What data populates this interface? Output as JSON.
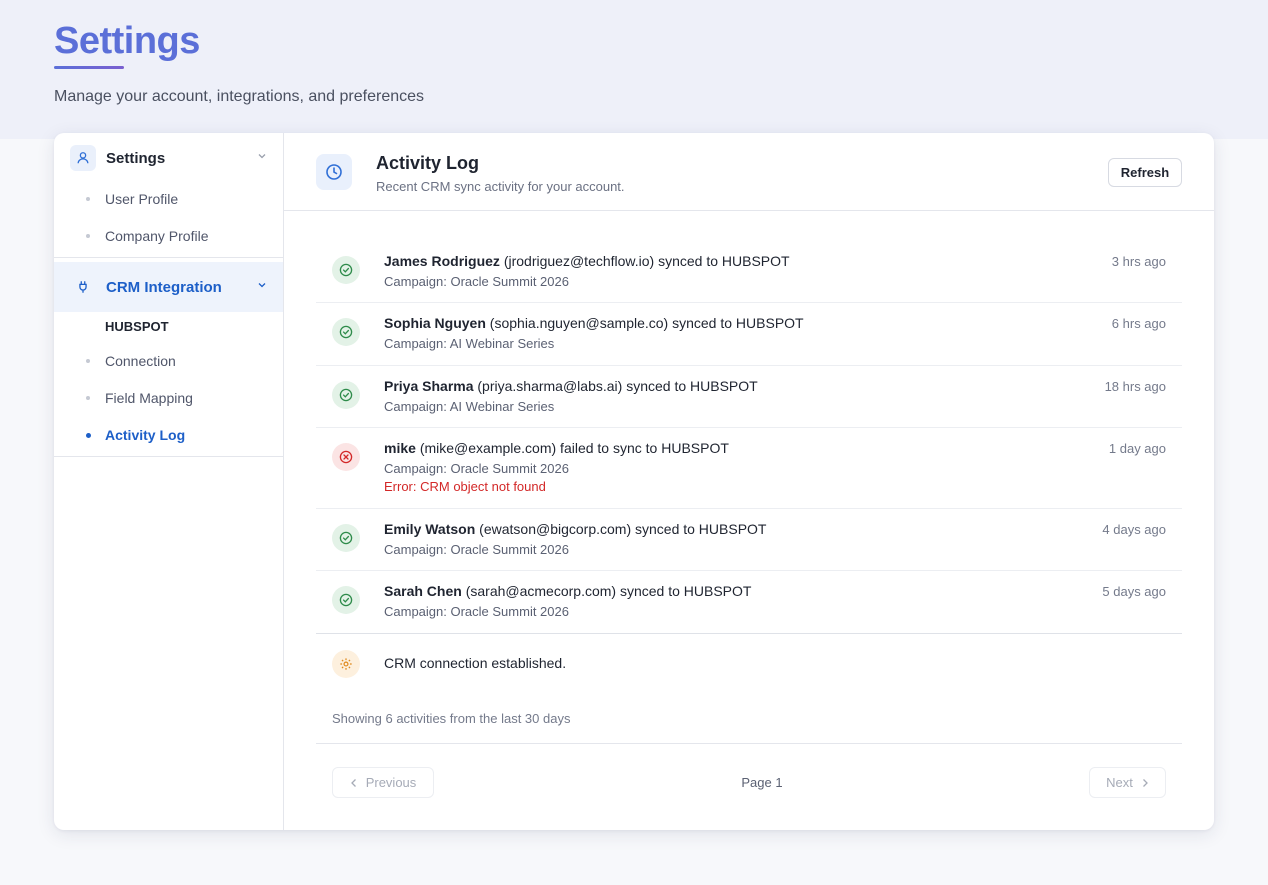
{
  "page": {
    "title": "Settings",
    "subtitle": "Manage your account, integrations, and preferences"
  },
  "sidebar": {
    "settings_section": {
      "label": "Settings",
      "items": [
        {
          "label": "User Profile"
        },
        {
          "label": "Company Profile"
        }
      ]
    },
    "crm_section": {
      "label": "CRM Integration",
      "group_label": "HUBSPOT",
      "items": [
        {
          "label": "Connection",
          "active": false
        },
        {
          "label": "Field Mapping",
          "active": false
        },
        {
          "label": "Activity Log",
          "active": true
        }
      ]
    }
  },
  "main": {
    "title": "Activity Log",
    "subtitle": "Recent CRM sync activity for your account.",
    "refresh_label": "Refresh",
    "activities": [
      {
        "status": "success",
        "name": "James Rodriguez",
        "detail": "(jrodriguez@techflow.io) synced to HUBSPOT",
        "campaign": "Campaign: Oracle Summit 2026",
        "time": "3 hrs ago"
      },
      {
        "status": "success",
        "name": "Sophia Nguyen",
        "detail": "(sophia.nguyen@sample.co) synced to HUBSPOT",
        "campaign": "Campaign: AI Webinar Series",
        "time": "6 hrs ago"
      },
      {
        "status": "success",
        "name": "Priya Sharma",
        "detail": "(priya.sharma@labs.ai) synced to HUBSPOT",
        "campaign": "Campaign: AI Webinar Series",
        "time": "18 hrs ago"
      },
      {
        "status": "error",
        "name": "mike",
        "detail": "(mike@example.com) failed to sync to HUBSPOT",
        "campaign": "Campaign: Oracle Summit 2026",
        "error": "Error: CRM object not found",
        "time": "1 day ago"
      },
      {
        "status": "success",
        "name": "Emily Watson",
        "detail": "(ewatson@bigcorp.com) synced to HUBSPOT",
        "campaign": "Campaign: Oracle Summit 2026",
        "time": "4 days ago"
      },
      {
        "status": "success",
        "name": "Sarah Chen",
        "detail": "(sarah@acmecorp.com) synced to HUBSPOT",
        "campaign": "Campaign: Oracle Summit 2026",
        "time": "5 days ago"
      }
    ],
    "system_event": "CRM connection established.",
    "summary": "Showing 6 activities from the last 30 days",
    "pagination": {
      "previous_label": "Previous",
      "page_label": "Page 1",
      "next_label": "Next"
    }
  },
  "colors": {
    "accent": "#5b6fd8",
    "active_link": "#1d5fc8",
    "success": "#2e8b4a",
    "error": "#d32828",
    "system": "#e08a1e"
  },
  "icons": {
    "settings_section": "user-icon",
    "crm_section": "plug-icon",
    "header": "clock-icon",
    "success": "check-circle-icon",
    "error": "x-circle-icon",
    "system": "gear-icon"
  }
}
